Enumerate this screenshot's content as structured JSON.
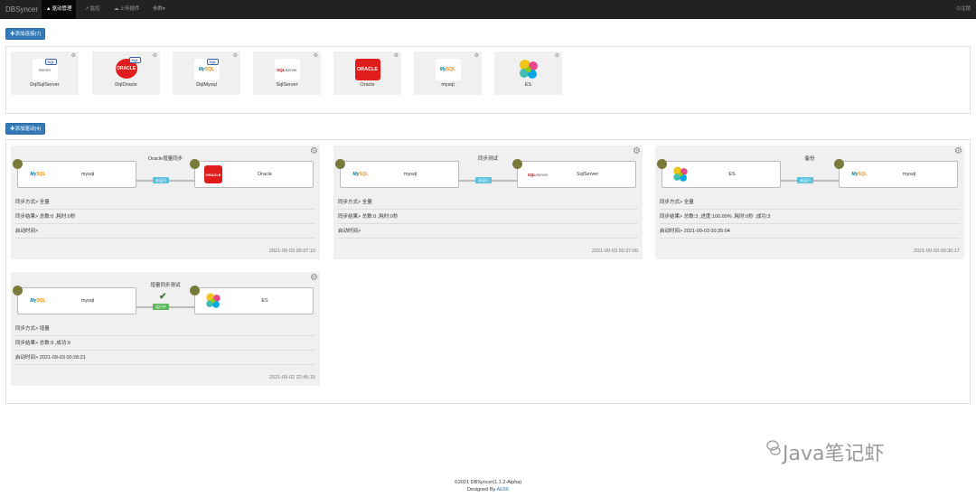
{
  "navbar": {
    "brand": "DBSyncer",
    "items": [
      {
        "icon": "▲",
        "label": "驱动管理"
      },
      {
        "icon": "↗",
        "label": "监控"
      },
      {
        "icon": "☁",
        "label": "上传插件"
      },
      {
        "label": "参数",
        "caret": "▾"
      }
    ],
    "logout": {
      "icon": "⏻",
      "label": "注销"
    }
  },
  "add_connector_button": "✚添加连接(7)",
  "add_driver_button": "✚添加驱动(4)",
  "connectors": [
    {
      "name": "DqlSqlServer",
      "logo": "sqlserver-logo",
      "tag": "SQL"
    },
    {
      "name": "DqlOracle",
      "logo": "oracle-logo",
      "tag": "SQL"
    },
    {
      "name": "DqlMysql",
      "logo": "mysql-logo",
      "tag": "SQL"
    },
    {
      "name": "SqlServer",
      "logo": "sqlserver-logo"
    },
    {
      "name": "Oracle",
      "logo": "oracle-logo"
    },
    {
      "name": "mysql",
      "logo": "mysql-logo"
    },
    {
      "name": "ES",
      "logo": "es-logo"
    }
  ],
  "logos": {
    "oracle": "ORACLE",
    "sqlserver_a": "SQL",
    "sqlserver_b": "Server",
    "mysql_a": "My",
    "mysql_b": "SQL"
  },
  "drivers": [
    {
      "title": "Oracle增量同步",
      "source": "mysql",
      "target": "Oracle",
      "status": "未运行",
      "sync_mode": "同步方式> 全量",
      "sync_result": "同步结果> 总数:0 ,耗时:0秒",
      "start_time": "启动时间>",
      "timestamp": "2021-09-03 00:37:10"
    },
    {
      "title": "同步测试",
      "source": "mysql",
      "target": "SqlServer",
      "status": "未运行",
      "sync_mode": "同步方式> 全量",
      "sync_result": "同步结果> 总数:0 ,耗时:0秒",
      "start_time": "启动时间>",
      "timestamp": "2021-09-03 00:37:00"
    },
    {
      "title": "备份",
      "source": "ES",
      "target": "mysql",
      "status": "未运行",
      "sync_mode": "同步方式> 全量",
      "sync_result": "同步结果> 总数:3 ,进度:100.00% ,耗时:0秒 ,成功:3",
      "start_time": "启动时间> 2021-09-03 00:35:04",
      "timestamp": "2021-09-03 00:30:17"
    },
    {
      "title": "增量同步测试",
      "source": "mysql",
      "target": "ES",
      "status": "运行中",
      "check": "✔",
      "sync_mode": "同步方式> 增量",
      "sync_result": "同步结果> 总数:9 ,成功:9",
      "start_time": "启动时间> 2021-09-03 00:28:21",
      "timestamp": "2021-09-02 22:45:15"
    }
  ],
  "footer": {
    "copyright": "©2021 DBSyncer(1.1.2-Alpha)",
    "designed_by": "Designed By ",
    "author": "AE86"
  },
  "watermark": "Java笔记虾",
  "colors": {
    "navbar": "#222222",
    "primary": "#337ab7",
    "status_stopped": "#5bc0de",
    "status_running": "#5cb85c",
    "oracle_red": "#e01d1d",
    "node_dot": "#7a7a3a"
  }
}
